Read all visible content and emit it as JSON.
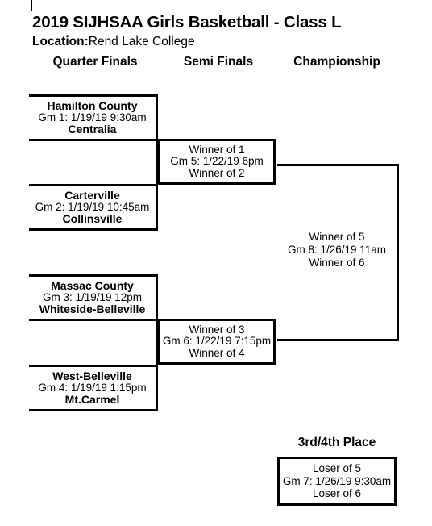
{
  "header": {
    "title": "2019 SIJHSAA Girls Basketball - Class L",
    "location_label": "Location:",
    "location_value": "Rend Lake College"
  },
  "rounds": [
    {
      "label": "Quarter Finals"
    },
    {
      "label": "Semi Finals"
    },
    {
      "label": "Championship"
    }
  ],
  "quarter_finals": [
    {
      "top_team": "Hamilton County",
      "meta": "Gm 1: 1/19/19 9:30am",
      "bottom_team": "Centralia"
    },
    {
      "top_team": "Carterville",
      "meta": "Gm 2: 1/19/19 10:45am",
      "bottom_team": "Collinsville"
    },
    {
      "top_team": "Massac County",
      "meta": "Gm 3: 1/19/19 12pm",
      "bottom_team": "Whiteside-Belleville"
    },
    {
      "top_team": "West-Belleville",
      "meta": "Gm 4: 1/19/19 1:15pm",
      "bottom_team": "Mt.Carmel"
    }
  ],
  "semi_finals": [
    {
      "top_team": "Winner of 1",
      "meta": "Gm 5: 1/22/19 6pm",
      "bottom_team": "Winner of 2"
    },
    {
      "top_team": "Winner of 3",
      "meta": "Gm 6: 1/22/19 7:15pm",
      "bottom_team": "Winner of 4"
    }
  ],
  "championship": {
    "top_team": "Winner of 5",
    "meta": "Gm 8: 1/26/19 11am",
    "bottom_team": "Winner of 6"
  },
  "consolation": {
    "title": "3rd/4th Place",
    "top_team": "Loser of 5",
    "meta": "Gm 7: 1/26/19 9:30am",
    "bottom_team": "Loser of 6"
  }
}
